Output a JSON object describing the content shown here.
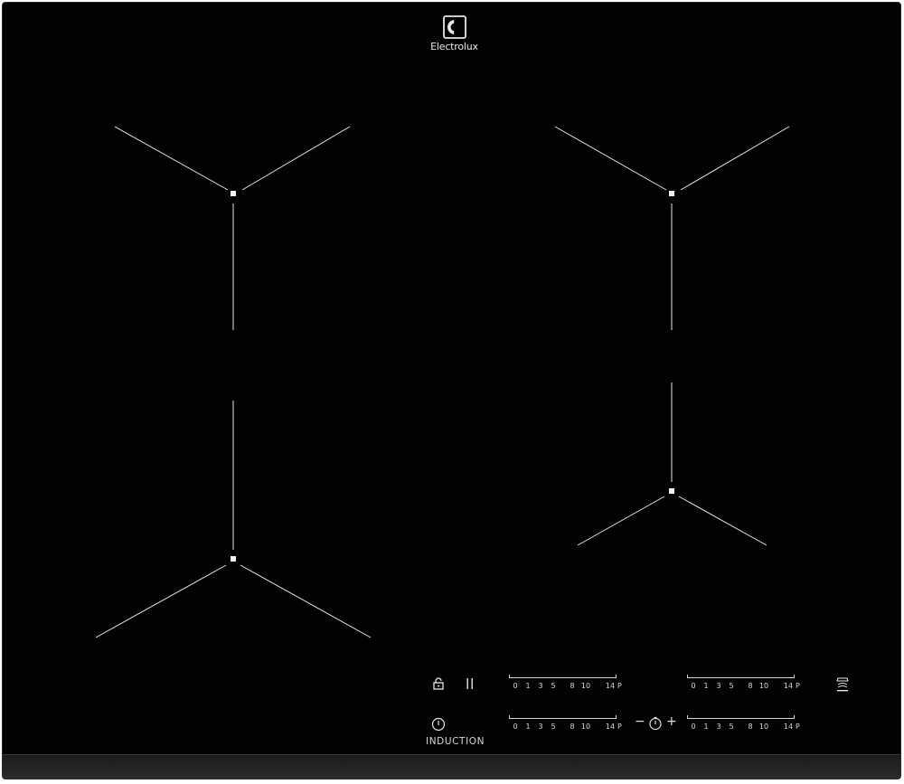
{
  "brand": {
    "name": "Electrolux",
    "logo_icon": "electrolux-logo-icon"
  },
  "colors": {
    "glass": "#020202",
    "marking": "#e6e6e6",
    "edge": "#2c2c2c"
  },
  "controls": {
    "lock_icon": "lock-icon",
    "pause_icon": "pause-icon",
    "power_icon": "power-icon",
    "induction_label": "INDUCTION",
    "hood_icon": "hob-to-hood-icon",
    "timer": {
      "minus": "−",
      "plus": "+",
      "icon": "timer-icon"
    }
  },
  "sliders": [
    {
      "id": "front-left",
      "labels": [
        "0",
        "1",
        "3",
        "5",
        "8",
        "10",
        "14",
        "P"
      ]
    },
    {
      "id": "rear-left",
      "labels": [
        "0",
        "1",
        "3",
        "5",
        "8",
        "10",
        "14",
        "P"
      ]
    },
    {
      "id": "rear-right",
      "labels": [
        "0",
        "1",
        "3",
        "5",
        "8",
        "10",
        "14",
        "P"
      ]
    },
    {
      "id": "front-right",
      "labels": [
        "0",
        "1",
        "3",
        "5",
        "8",
        "10",
        "14",
        "P"
      ]
    }
  ]
}
